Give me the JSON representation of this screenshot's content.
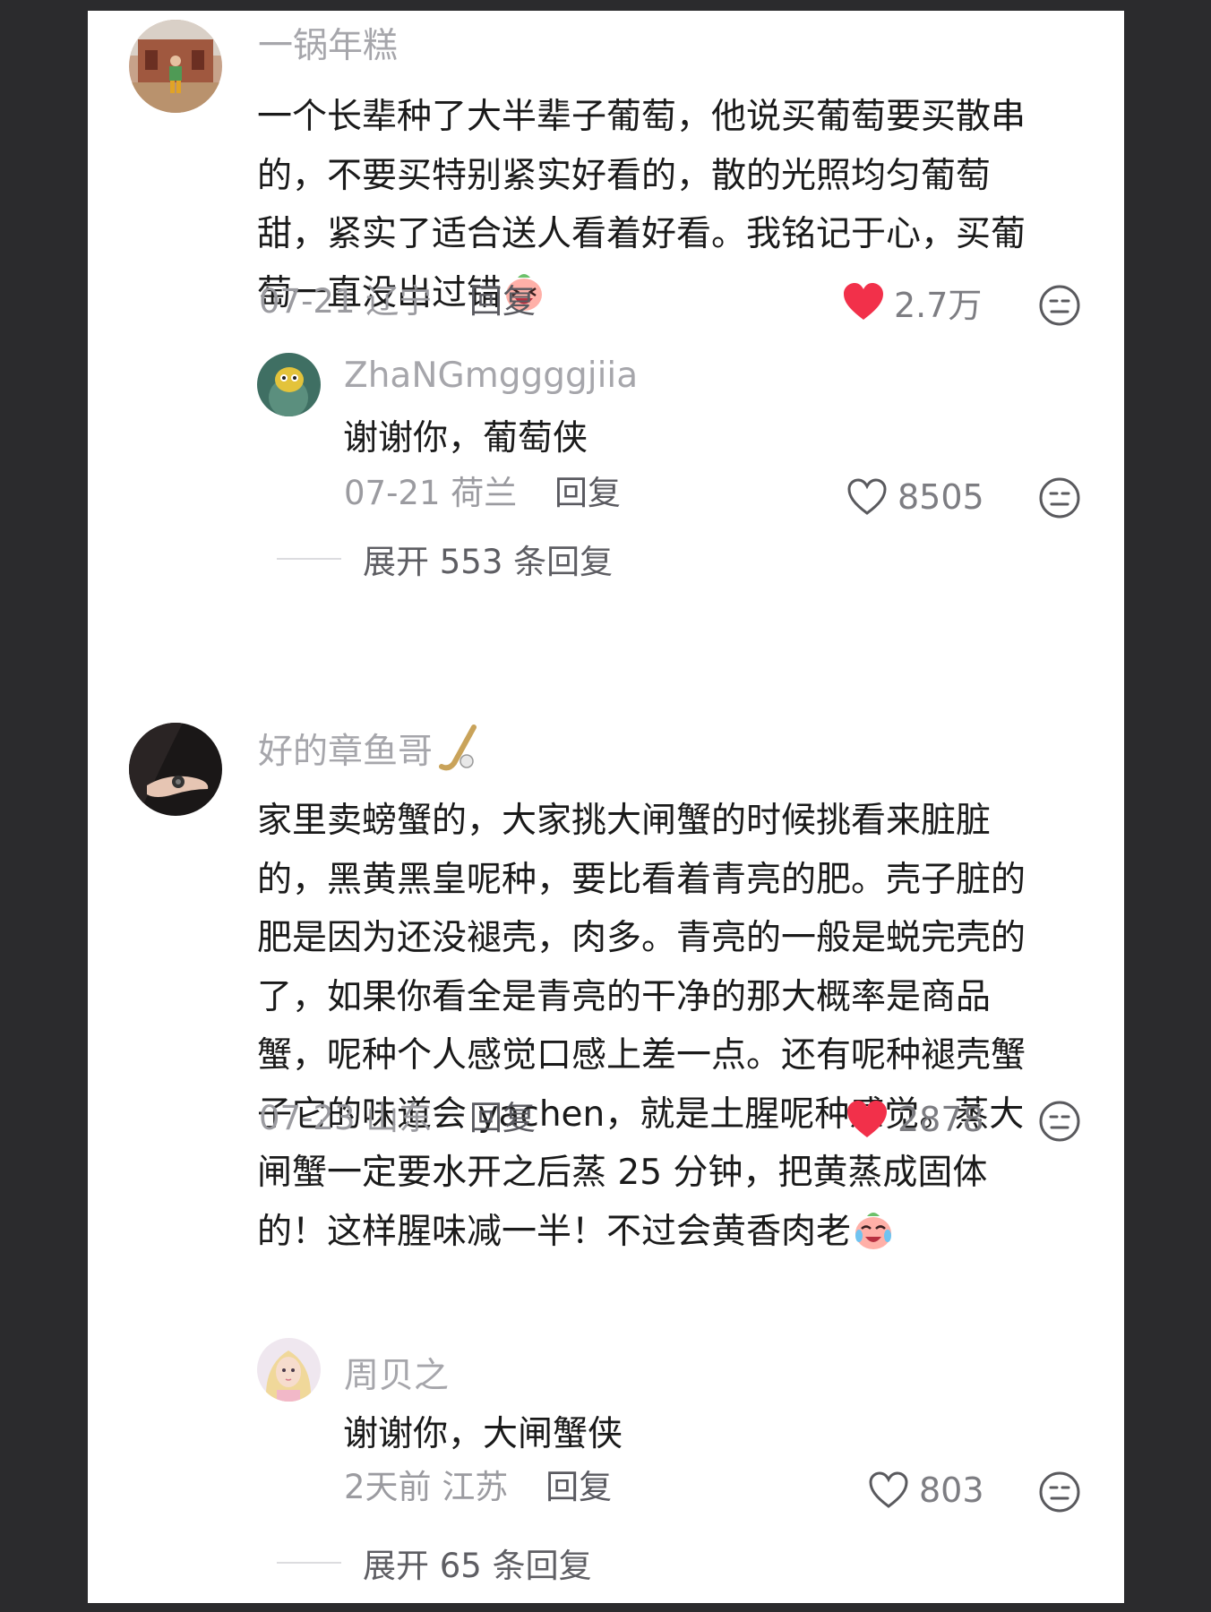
{
  "comments": [
    {
      "username": "一锅年糕",
      "lines": [
        "一个长辈种了大半辈子葡萄，他说买葡萄要买散串",
        "的，不要买特别紧实好看的，散的光照均匀葡萄",
        "甜，紧实了适合送人看着好看。我铭记于心，买葡",
        "萄一直没出过错"
      ],
      "date": "07-21",
      "location": "辽宁",
      "reply_label": "回复",
      "likes": "2.7万",
      "liked": true,
      "replies": [
        {
          "username": "ZhaNGmggggjiia",
          "text": "谢谢你，葡萄侠",
          "date": "07-21",
          "location": "荷兰",
          "reply_label": "回复",
          "likes": "8505",
          "liked": false
        }
      ],
      "expand_label": "展开 553 条回复"
    },
    {
      "username": "好的章鱼哥",
      "lines": [
        "家里卖螃蟹的，大家挑大闸蟹的时候挑看来脏脏",
        "的，黑黄黑皇呢种，要比看着青亮的肥。壳子脏的",
        "肥是因为还没褪壳，肉多。青亮的一般是蜕完壳的",
        "了，如果你看全是青亮的干净的那大概率是商品",
        "蟹，呢种个人感觉口感上差一点。还有呢种褪壳蟹",
        "子它的味道会 yachen，就是土腥呢种感觉。蒸大",
        "闸蟹一定要水开之后蒸 25 分钟，把黄蒸成固体",
        "的！这样腥味减一半！不过会黄香肉老"
      ],
      "date": "07-23",
      "location": "山东",
      "reply_label": "回复",
      "likes": "2878",
      "liked": true,
      "replies": [
        {
          "username": "周贝之",
          "text": "谢谢你，大闸蟹侠",
          "date": "2天前",
          "location": "江苏",
          "reply_label": "回复",
          "likes": "803",
          "liked": false
        }
      ],
      "expand_label": "展开 65 条回复"
    }
  ],
  "icons": {
    "like_filled_color": "#f2304a",
    "like_outline_color": "#5a5a5e",
    "emoji_1": "laughing-peach-emoji",
    "emoji_2": "crying-laughing-peach-emoji",
    "badge": "hockey-stick-badge",
    "face_button": "neutral-face-icon"
  }
}
